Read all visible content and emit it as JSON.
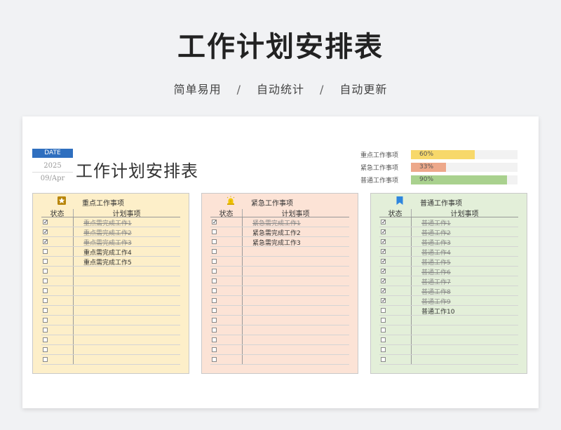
{
  "header": {
    "title": "工作计划安排表",
    "subtitle_items": [
      "简单易用",
      "自动统计",
      "自动更新"
    ],
    "separator": "/"
  },
  "sheet": {
    "date_label": "DATE",
    "year": "2025",
    "day": "09/Apr",
    "title": "工作计划安排表"
  },
  "stats": [
    {
      "label": "重点工作事项",
      "percent": "60%",
      "value": 0.6,
      "color": "#f7d86a"
    },
    {
      "label": "紧急工作事项",
      "percent": "33%",
      "value": 0.33,
      "color": "#eda88a"
    },
    {
      "label": "普通工作事项",
      "percent": "90%",
      "value": 0.9,
      "color": "#a9d18e"
    }
  ],
  "panels": [
    {
      "key": "key",
      "title": "重点工作事项",
      "icon": "star-badge-icon",
      "bg": "#fdefc9",
      "status_header": "状态",
      "task_header": "计划事项",
      "rows": [
        {
          "checked": true,
          "task": "重点需完成工作1"
        },
        {
          "checked": true,
          "task": "重点需完成工作2"
        },
        {
          "checked": true,
          "task": "重点需完成工作3"
        },
        {
          "checked": false,
          "task": "重点需完成工作4"
        },
        {
          "checked": false,
          "task": "重点需完成工作5"
        },
        {
          "checked": false,
          "task": ""
        },
        {
          "checked": false,
          "task": ""
        },
        {
          "checked": false,
          "task": ""
        },
        {
          "checked": false,
          "task": ""
        },
        {
          "checked": false,
          "task": ""
        },
        {
          "checked": false,
          "task": ""
        },
        {
          "checked": false,
          "task": ""
        },
        {
          "checked": false,
          "task": ""
        },
        {
          "checked": false,
          "task": ""
        },
        {
          "checked": false,
          "task": ""
        }
      ]
    },
    {
      "key": "urgent",
      "title": "紧急工作事项",
      "icon": "alarm-bell-icon",
      "bg": "#fce3d6",
      "status_header": "状态",
      "task_header": "计划事项",
      "rows": [
        {
          "checked": true,
          "task": "紧急需完成工作1"
        },
        {
          "checked": false,
          "task": "紧急需完成工作2"
        },
        {
          "checked": false,
          "task": "紧急需完成工作3"
        },
        {
          "checked": false,
          "task": ""
        },
        {
          "checked": false,
          "task": ""
        },
        {
          "checked": false,
          "task": ""
        },
        {
          "checked": false,
          "task": ""
        },
        {
          "checked": false,
          "task": ""
        },
        {
          "checked": false,
          "task": ""
        },
        {
          "checked": false,
          "task": ""
        },
        {
          "checked": false,
          "task": ""
        },
        {
          "checked": false,
          "task": ""
        },
        {
          "checked": false,
          "task": ""
        },
        {
          "checked": false,
          "task": ""
        },
        {
          "checked": false,
          "task": ""
        }
      ]
    },
    {
      "key": "normal",
      "title": "普通工作事项",
      "icon": "bookmark-icon",
      "bg": "#e3efd9",
      "status_header": "状态",
      "task_header": "计划事项",
      "rows": [
        {
          "checked": true,
          "task": "普通工作1"
        },
        {
          "checked": true,
          "task": "普通工作2"
        },
        {
          "checked": true,
          "task": "普通工作3"
        },
        {
          "checked": true,
          "task": "普通工作4"
        },
        {
          "checked": true,
          "task": "普通工作5"
        },
        {
          "checked": true,
          "task": "普通工作6"
        },
        {
          "checked": true,
          "task": "普通工作7"
        },
        {
          "checked": true,
          "task": "普通工作8"
        },
        {
          "checked": true,
          "task": "普通工作9"
        },
        {
          "checked": false,
          "task": "普通工作10"
        },
        {
          "checked": false,
          "task": ""
        },
        {
          "checked": false,
          "task": ""
        },
        {
          "checked": false,
          "task": ""
        },
        {
          "checked": false,
          "task": ""
        },
        {
          "checked": false,
          "task": ""
        }
      ]
    }
  ]
}
